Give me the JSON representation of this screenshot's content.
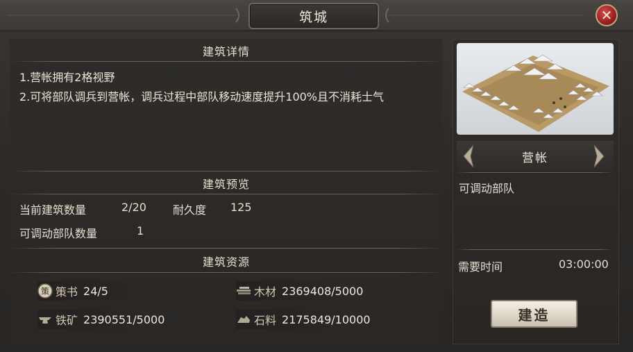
{
  "window": {
    "title": "筑城"
  },
  "details": {
    "heading": "建筑详情",
    "lines": [
      "1.营帐拥有2格视野",
      "2.可将部队调兵到营帐，调兵过程中部队移动速度提升100%且不消耗士气"
    ]
  },
  "preview": {
    "heading": "建筑预览",
    "count_label": "当前建筑数量",
    "count_value": "2/20",
    "durability_label": "耐久度",
    "durability_value": "125",
    "troops_label": "可调动部队数量",
    "troops_value": "1"
  },
  "resources": {
    "heading": "建筑资源",
    "items": [
      {
        "icon": "book-seal-icon",
        "label": "策书",
        "value": "24/5"
      },
      {
        "icon": "wood-icon",
        "label": "木材",
        "value": "2369408/5000"
      },
      {
        "icon": "iron-anvil-icon",
        "label": "铁矿",
        "value": "2390551/5000"
      },
      {
        "icon": "stone-icon",
        "label": "石料",
        "value": "2175849/10000"
      }
    ]
  },
  "building": {
    "name": "营帐",
    "description": "可调动部队",
    "time_label": "需要时间",
    "time_value": "03:00:00",
    "build_label": "建造",
    "book_glyph": "策"
  },
  "colors": {
    "close_red": "#b02a2a",
    "accent_gold": "#b9a884"
  }
}
